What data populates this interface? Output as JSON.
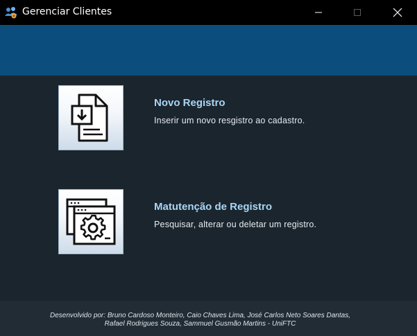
{
  "window": {
    "title": "Gerenciar Clientes",
    "icons": {
      "app": "users-app-icon",
      "minimize": "minimize-icon",
      "maximize": "maximize-icon",
      "close": "close-icon"
    }
  },
  "menu": {
    "items": [
      {
        "icon": "new-document-icon",
        "title": "Novo Registro",
        "description": "Inserir um novo resgistro ao cadastro."
      },
      {
        "icon": "settings-window-icon",
        "title": "Matutenção de Registro",
        "description": "Pesquisar, alterar ou deletar um registro."
      }
    ]
  },
  "footer": {
    "line1": "Desenvolvido por: Bruno Cardoso Monteiro, Caio Chaves Lima, José Carlos Neto Soares Dantas,",
    "line2": "Rafael Rodrigues Souza, Sammuel Gusmão Martins - UniFTC"
  },
  "colors": {
    "titlebar": "#000000",
    "banner": "#0b4e7e",
    "background": "#1b252d",
    "footer": "#222c34",
    "item_title": "#a9d6f5"
  }
}
